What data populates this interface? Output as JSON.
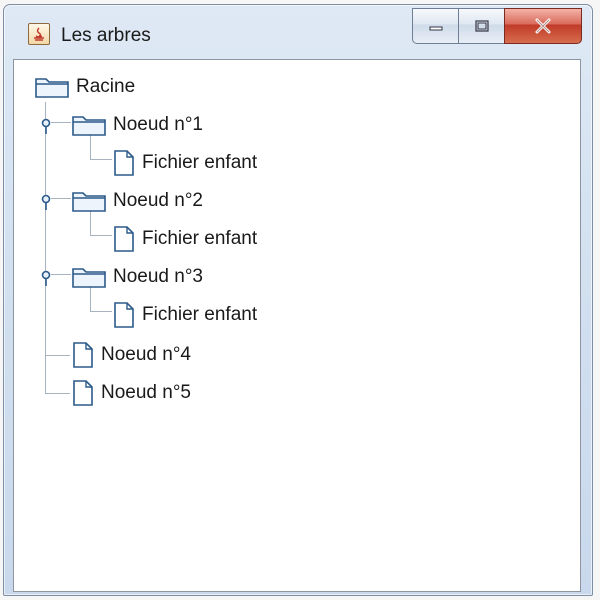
{
  "window": {
    "title": "Les arbres",
    "icon": "java-app-icon"
  },
  "window_buttons": {
    "minimize": "minimize-icon",
    "maximize": "maximize-icon",
    "close": "close-icon"
  },
  "tree": {
    "root": {
      "label": "Racine",
      "icon": "folder-icon"
    },
    "nodes": [
      {
        "label": "Noeud n°1",
        "icon": "folder-icon",
        "expanded": true,
        "child": {
          "label": "Fichier enfant",
          "icon": "file-icon"
        }
      },
      {
        "label": "Noeud n°2",
        "icon": "folder-icon",
        "expanded": true,
        "child": {
          "label": "Fichier enfant",
          "icon": "file-icon"
        }
      },
      {
        "label": "Noeud n°3",
        "icon": "folder-icon",
        "expanded": true,
        "child": {
          "label": "Fichier enfant",
          "icon": "file-icon"
        }
      },
      {
        "label": "Noeud n°4",
        "icon": "file-icon"
      },
      {
        "label": "Noeud n°5",
        "icon": "file-icon"
      }
    ]
  },
  "colors": {
    "icon_stroke": "#2b5a8a",
    "tree_lines": "#a8b3c0",
    "close_button": "#c03a27"
  }
}
